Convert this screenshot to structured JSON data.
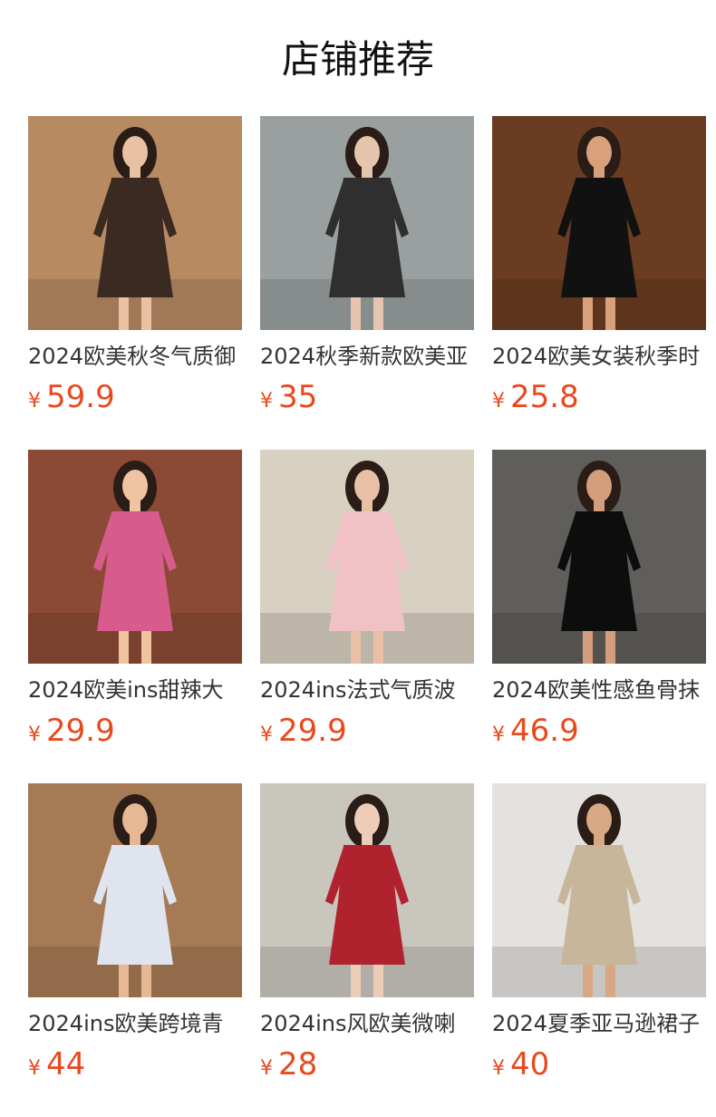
{
  "page": {
    "title": "店铺推荐"
  },
  "products": [
    {
      "name": "2024欧美秋冬气质御",
      "currency": "¥",
      "price": "59.9",
      "bg": "#b88a62",
      "accent": "#3a2a22",
      "skin": "#e8c2a3",
      "icon": "product-photo-icon"
    },
    {
      "name": "2024秋季新款欧美亚",
      "currency": "¥",
      "price": "35",
      "bg": "#9aa0a0",
      "accent": "#2f2f2f",
      "skin": "#e6c5ae",
      "icon": "product-photo-icon"
    },
    {
      "name": "2024欧美女装秋季时",
      "currency": "¥",
      "price": "25.8",
      "bg": "#6a3d22",
      "accent": "#111111",
      "skin": "#d9a07c",
      "icon": "product-photo-icon"
    },
    {
      "name": "2024欧美ins甜辣大",
      "currency": "¥",
      "price": "29.9",
      "bg": "#8b4a36",
      "accent": "#d85b8e",
      "skin": "#f0c4a0",
      "icon": "product-photo-icon"
    },
    {
      "name": "2024ins法式气质波",
      "currency": "¥",
      "price": "29.9",
      "bg": "#d8d0c0",
      "accent": "#f0c2c6",
      "skin": "#e9c0a5",
      "icon": "product-photo-icon"
    },
    {
      "name": "2024欧美性感鱼骨抹",
      "currency": "¥",
      "price": "46.9",
      "bg": "#5f5e5a",
      "accent": "#0d0d0d",
      "skin": "#d49e7c",
      "icon": "product-photo-icon"
    },
    {
      "name": "2024ins欧美跨境青",
      "currency": "¥",
      "price": "44",
      "bg": "#a57a55",
      "accent": "#dfe4ef",
      "skin": "#e6b894",
      "icon": "product-photo-icon"
    },
    {
      "name": "2024ins风欧美微喇",
      "currency": "¥",
      "price": "28",
      "bg": "#c9c6bd",
      "accent": "#b0222e",
      "skin": "#edcdb8",
      "icon": "product-photo-icon"
    },
    {
      "name": "2024夏季亚马逊裙子",
      "currency": "¥",
      "price": "40",
      "bg": "#e3e2df",
      "accent": "#c7b69a",
      "skin": "#d8a884",
      "icon": "product-photo-icon"
    }
  ],
  "colors": {
    "price": "#e8491d",
    "title": "#111111",
    "name": "#333333"
  }
}
